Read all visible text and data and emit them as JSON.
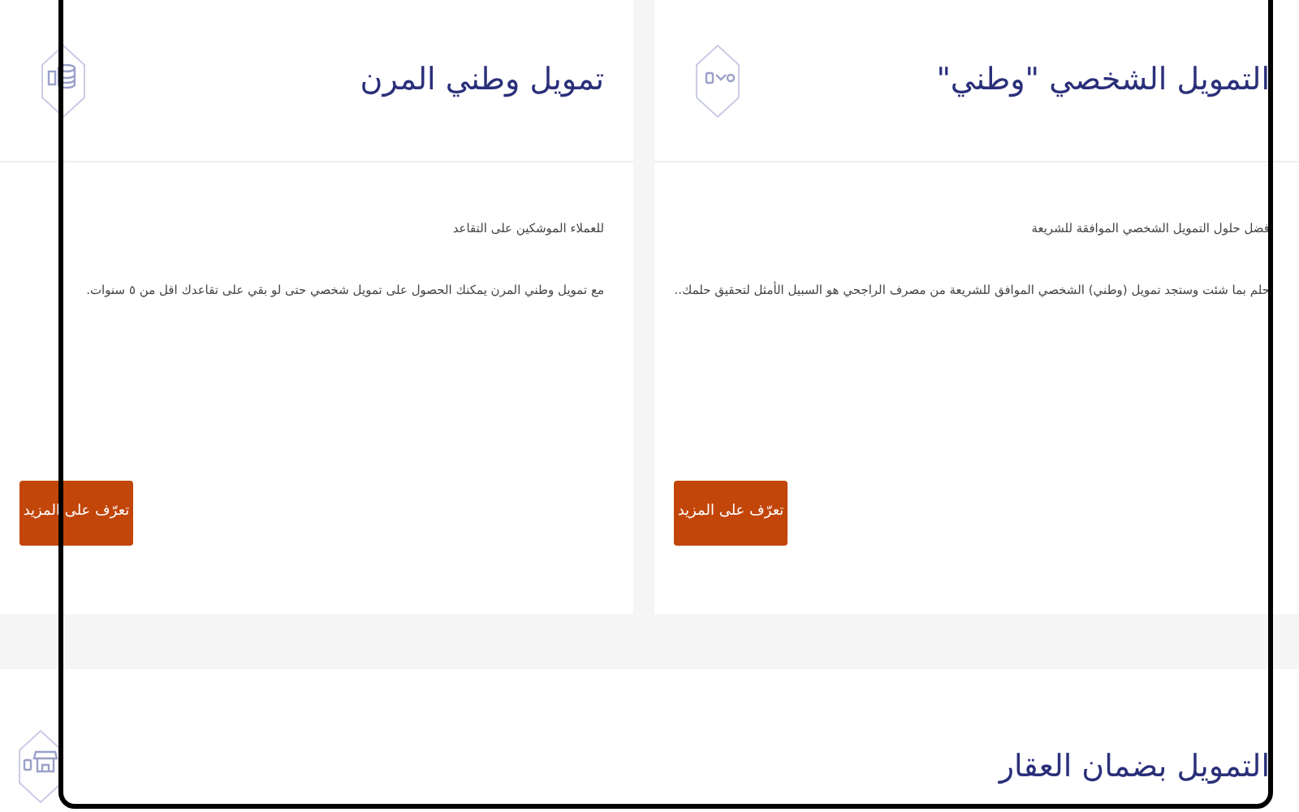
{
  "cards": [
    {
      "title": "التمويل الشخصي \"وطني\"",
      "paragraphs": [
        "فضل حلول التمويل الشخصي الموافقة للشريعة",
        "حلم بما شئت وستجد تمويل (وطني) الشخصي الموافق للشريعة من مصرف الراجحي هو السبيل الأمثل لتحقيق حلمك.."
      ],
      "button": "تعرّف على المزيد"
    },
    {
      "title": "تمويل وطني المرن",
      "paragraphs": [
        "للعملاء الموشكين على التقاعد",
        "مع تمويل وطني المرن يمكنك الحصول على تمويل شخصي حتى لو بقي على تقاعدك اقل من ٥ سنوات."
      ],
      "button": "تعرّف على المزيد"
    }
  ],
  "section": {
    "title": "التمويل بضمان العقار"
  }
}
